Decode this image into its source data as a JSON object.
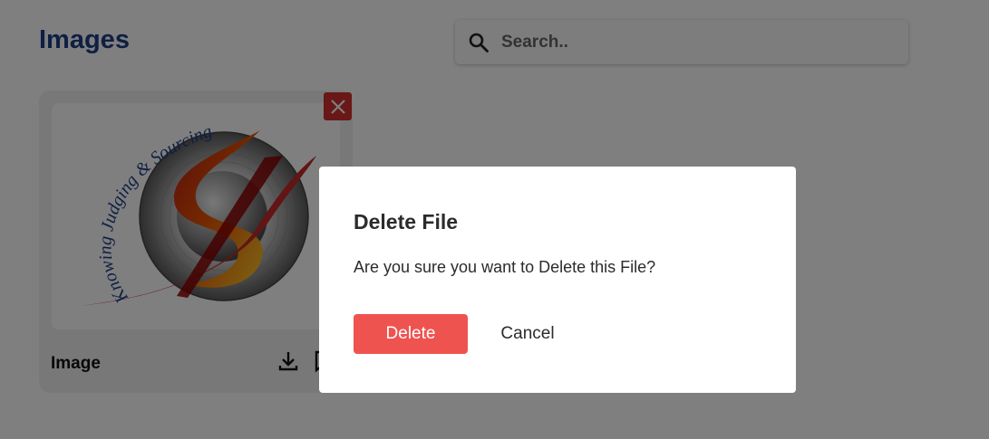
{
  "header": {
    "title": "Images"
  },
  "search": {
    "placeholder": "Search.."
  },
  "card": {
    "label": "Image",
    "logo_text": "Knowing Judging & Sourcing"
  },
  "icons": {
    "search": "search-icon",
    "close": "close-icon",
    "download": "download-icon",
    "bookmark": "bookmark-icon"
  },
  "modal": {
    "title": "Delete File",
    "message": "Are you sure you want to Delete this File?",
    "delete_label": "Delete",
    "cancel_label": "Cancel"
  },
  "colors": {
    "title": "#1f3f87",
    "close_button": "#d32f2f",
    "delete_button": "#ef5350"
  }
}
